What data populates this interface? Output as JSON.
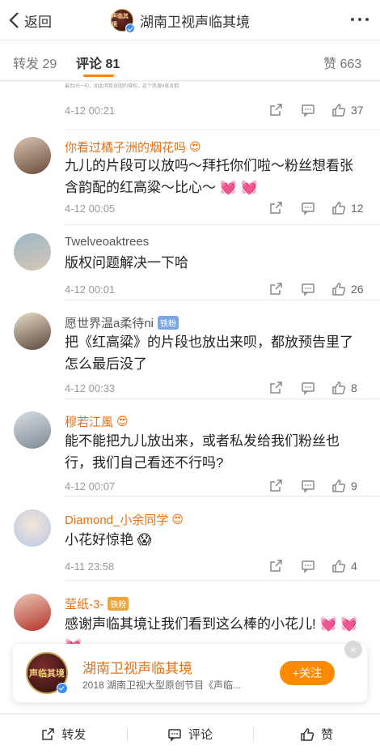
{
  "header": {
    "back_label": "返回",
    "title": "湖南卫视声临其境",
    "logo_text": "声临其境"
  },
  "tabs": [
    {
      "label": "转发 29"
    },
    {
      "label": "评论 81"
    },
    {
      "label": "赞 663"
    }
  ],
  "partial_text": "最后问一句，如此明目张胆的侵权，这个热搜#张含韵",
  "comments": [
    {
      "name": "",
      "text": "",
      "time": "4-12 00:21",
      "likes": "37"
    },
    {
      "name": "你看过橘子洲的烟花吗",
      "text": "九儿的片段可以放吗～拜托你们啦～粉丝想看张含韵配的红高粱～比心～ 💓 💓",
      "time": "4-12 00:05",
      "likes": "12"
    },
    {
      "name": "Twelveoaktrees",
      "text": "版权问题解决一下哈",
      "time": "4-12 00:01",
      "likes": "26"
    },
    {
      "name": "愿世界温a柔待ni",
      "badge": "铁粉",
      "text": "把《红高粱》的片段也放出来呗，都放预告里了怎么最后没了",
      "time": "4-12 00:33",
      "likes": "8"
    },
    {
      "name": "穆若江風",
      "text": "能不能把九儿放出来，或者私发给我们粉丝也行，我们自己看还不行吗?",
      "time": "4-12 00:07",
      "likes": "9"
    },
    {
      "name": "Diamond_小余同学",
      "text": "小花好惊艳 😱",
      "time": "4-11 23:58",
      "likes": "4"
    },
    {
      "name": "莹纸-3-",
      "badge": "铁粉",
      "text": "感谢声临其境让我们看到这么棒的小花儿! 💓 💓 💓",
      "time": "",
      "likes": ""
    }
  ],
  "follow_card": {
    "name": "湖南卫视声临其境",
    "description": "2018 湖南卫视大型原创节目《声临...",
    "button_label": "+关注",
    "logo_text": "声临其境"
  },
  "bottom_bar": {
    "repost_label": "转发",
    "comment_label": "评论",
    "like_label": "赞"
  },
  "colors": {
    "accent": "#ff8200",
    "name_orange": "#e86f10",
    "verified_blue": "#3b8ef0"
  }
}
